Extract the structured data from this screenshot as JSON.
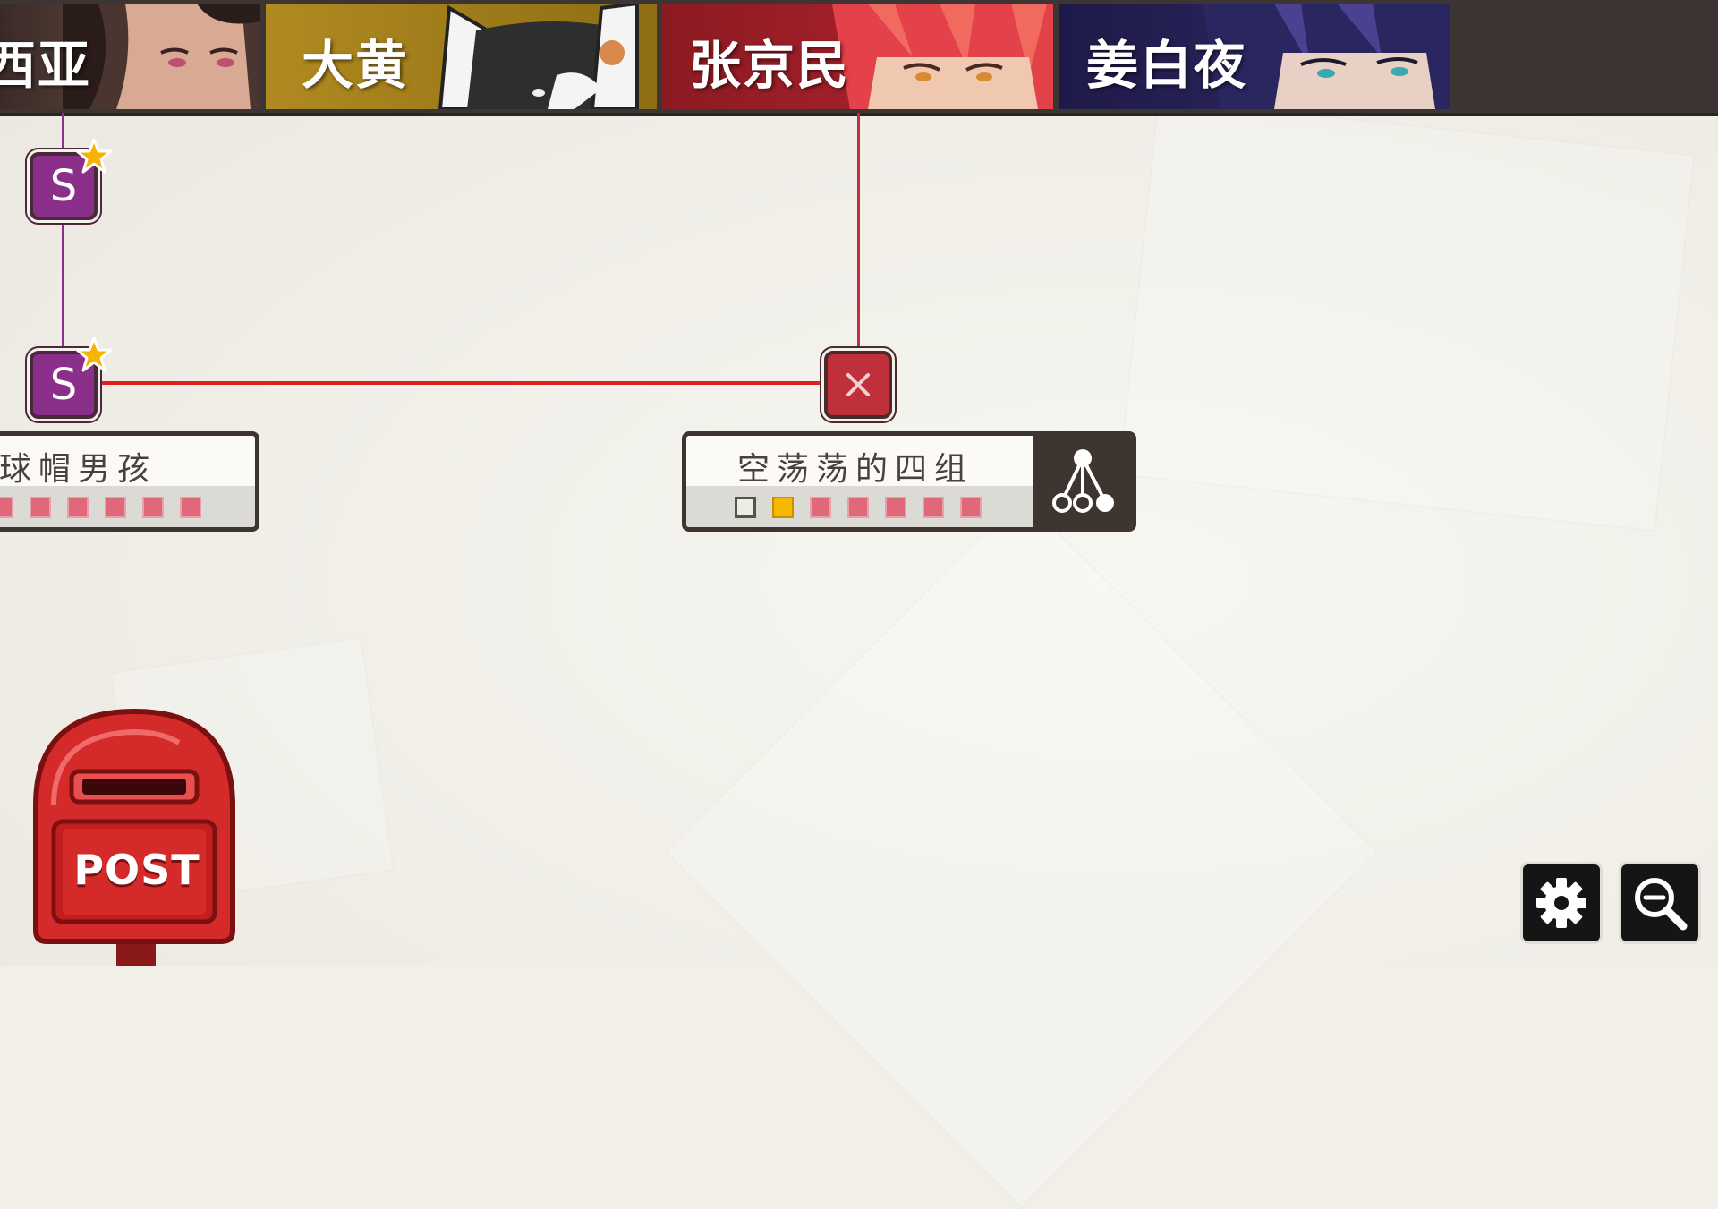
{
  "characters": [
    {
      "name": "西亚",
      "color": "#5a4642"
    },
    {
      "name": "大黄",
      "color": "#a8841a"
    },
    {
      "name": "张京民",
      "color": "#a51e28"
    },
    {
      "name": "姜白夜",
      "color": "#262150"
    }
  ],
  "nodes": {
    "s_node_top": {
      "label": "S",
      "starred": true
    },
    "s_node_bottom": {
      "label": "S",
      "starred": true
    },
    "fail_node": {
      "icon": "close-icon"
    }
  },
  "cards": {
    "left": {
      "title": "棒球帽男孩",
      "squares": [
        "pink",
        "pink",
        "pink",
        "pink",
        "pink",
        "pink",
        "pink"
      ]
    },
    "center": {
      "title": "空荡荡的四组",
      "squares": [
        "empty",
        "gold",
        "pink",
        "pink",
        "pink",
        "pink",
        "pink"
      ],
      "action_icon": "branch-tree-icon"
    }
  },
  "mailbox": {
    "label": "POST"
  },
  "controls": {
    "settings_icon": "gear-icon",
    "zoom_icon": "zoom-out-icon"
  },
  "colors": {
    "fail_line": "#e02020",
    "s_node": "#8a2f8a",
    "fail_node": "#c0303a"
  }
}
